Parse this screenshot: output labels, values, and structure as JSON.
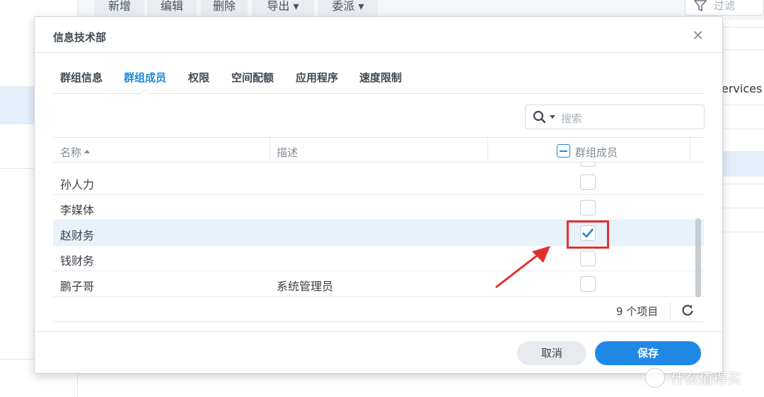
{
  "background": {
    "toolbar": [
      "新增",
      "编辑",
      "删除",
      "导出",
      "委派"
    ],
    "filter_placeholder": "过滤",
    "right_text": "ervices"
  },
  "dialog": {
    "title": "信息技术部",
    "close_icon": "close-icon",
    "tabs": [
      "群组信息",
      "群组成员",
      "权限",
      "空间配额",
      "应用程序",
      "速度限制"
    ],
    "active_tab": "群组成员",
    "search_placeholder": "搜索",
    "columns": {
      "name": "名称",
      "desc": "描述",
      "member": "群组成员"
    },
    "rows": [
      {
        "name": "孙人力",
        "desc": "",
        "member": false
      },
      {
        "name": "李媒体",
        "desc": "",
        "member": false
      },
      {
        "name": "赵财务",
        "desc": "",
        "member": true
      },
      {
        "name": "钱财务",
        "desc": "",
        "member": false
      },
      {
        "name": "鹏子哥",
        "desc": "系统管理员",
        "member": false
      }
    ],
    "count_text": "9 个项目",
    "buttons": {
      "cancel": "取消",
      "save": "保存"
    }
  },
  "watermark": "什么值得买",
  "colors": {
    "accent": "#1f88d6",
    "save_button": "#1f88e5",
    "annotation_red": "#e0312d",
    "selected_row": "#e8f2fb"
  }
}
